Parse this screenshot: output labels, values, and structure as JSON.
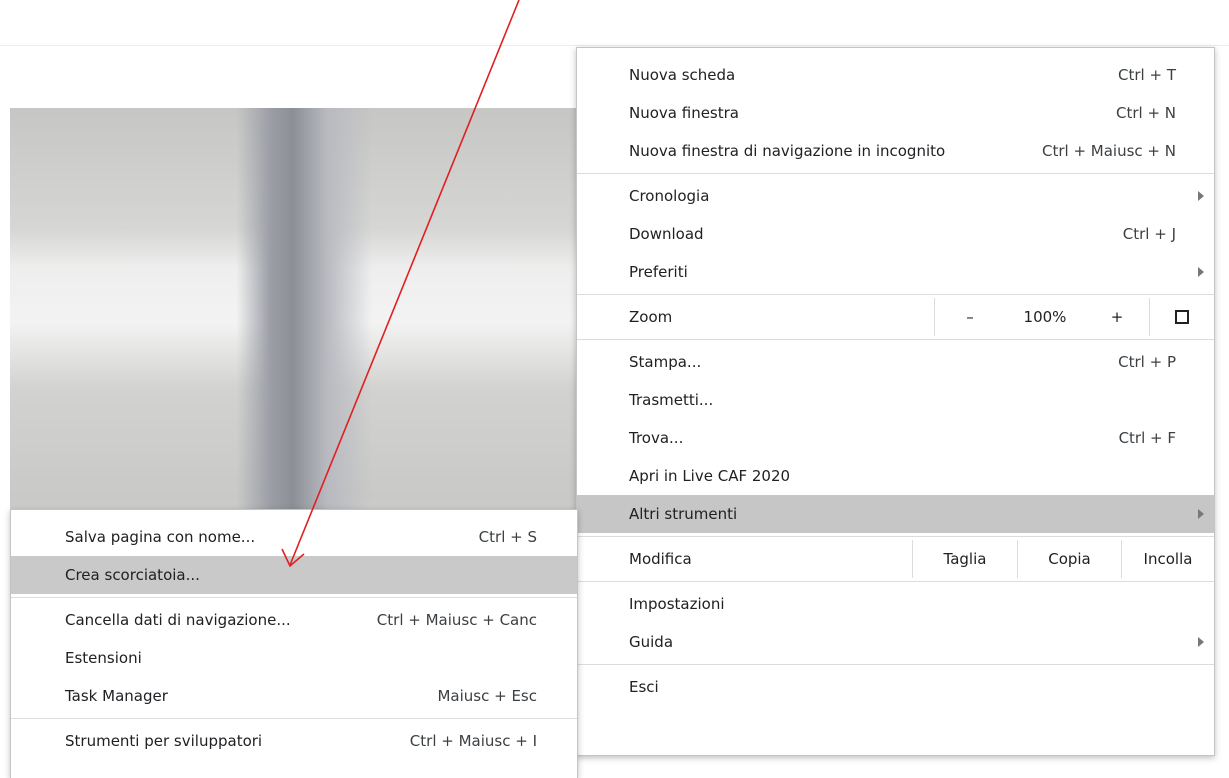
{
  "main_menu": {
    "new_tab": {
      "label": "Nuova scheda",
      "shortcut": "Ctrl + T"
    },
    "new_window": {
      "label": "Nuova finestra",
      "shortcut": "Ctrl + N"
    },
    "incognito": {
      "label": "Nuova finestra di navigazione in incognito",
      "shortcut": "Ctrl + Maiusc + N"
    },
    "history": {
      "label": "Cronologia"
    },
    "downloads": {
      "label": "Download",
      "shortcut": "Ctrl + J"
    },
    "bookmarks": {
      "label": "Preferiti"
    },
    "zoom": {
      "label": "Zoom",
      "minus": "–",
      "value": "100%",
      "plus": "+"
    },
    "print": {
      "label": "Stampa...",
      "shortcut": "Ctrl + P"
    },
    "cast": {
      "label": "Trasmetti..."
    },
    "find": {
      "label": "Trova...",
      "shortcut": "Ctrl + F"
    },
    "open_in": {
      "label": "Apri in Live CAF 2020"
    },
    "more_tools": {
      "label": "Altri strumenti"
    },
    "edit": {
      "label": "Modifica",
      "cut": "Taglia",
      "copy": "Copia",
      "paste": "Incolla"
    },
    "settings": {
      "label": "Impostazioni"
    },
    "help": {
      "label": "Guida"
    },
    "exit": {
      "label": "Esci"
    }
  },
  "sub_menu": {
    "save_page": {
      "label": "Salva pagina con nome...",
      "shortcut": "Ctrl + S"
    },
    "create_shortcut": {
      "label": "Crea scorciatoia..."
    },
    "clear_data": {
      "label": "Cancella dati di navigazione...",
      "shortcut": "Ctrl + Maiusc + Canc"
    },
    "extensions": {
      "label": "Estensioni"
    },
    "task_manager": {
      "label": "Task Manager",
      "shortcut": "Maiusc + Esc"
    },
    "dev_tools": {
      "label": "Strumenti per sviluppatori",
      "shortcut": "Ctrl + Maiusc + I"
    }
  },
  "colors": {
    "annotation_arrow": "#e02020",
    "highlight": "#c6c6c6"
  }
}
